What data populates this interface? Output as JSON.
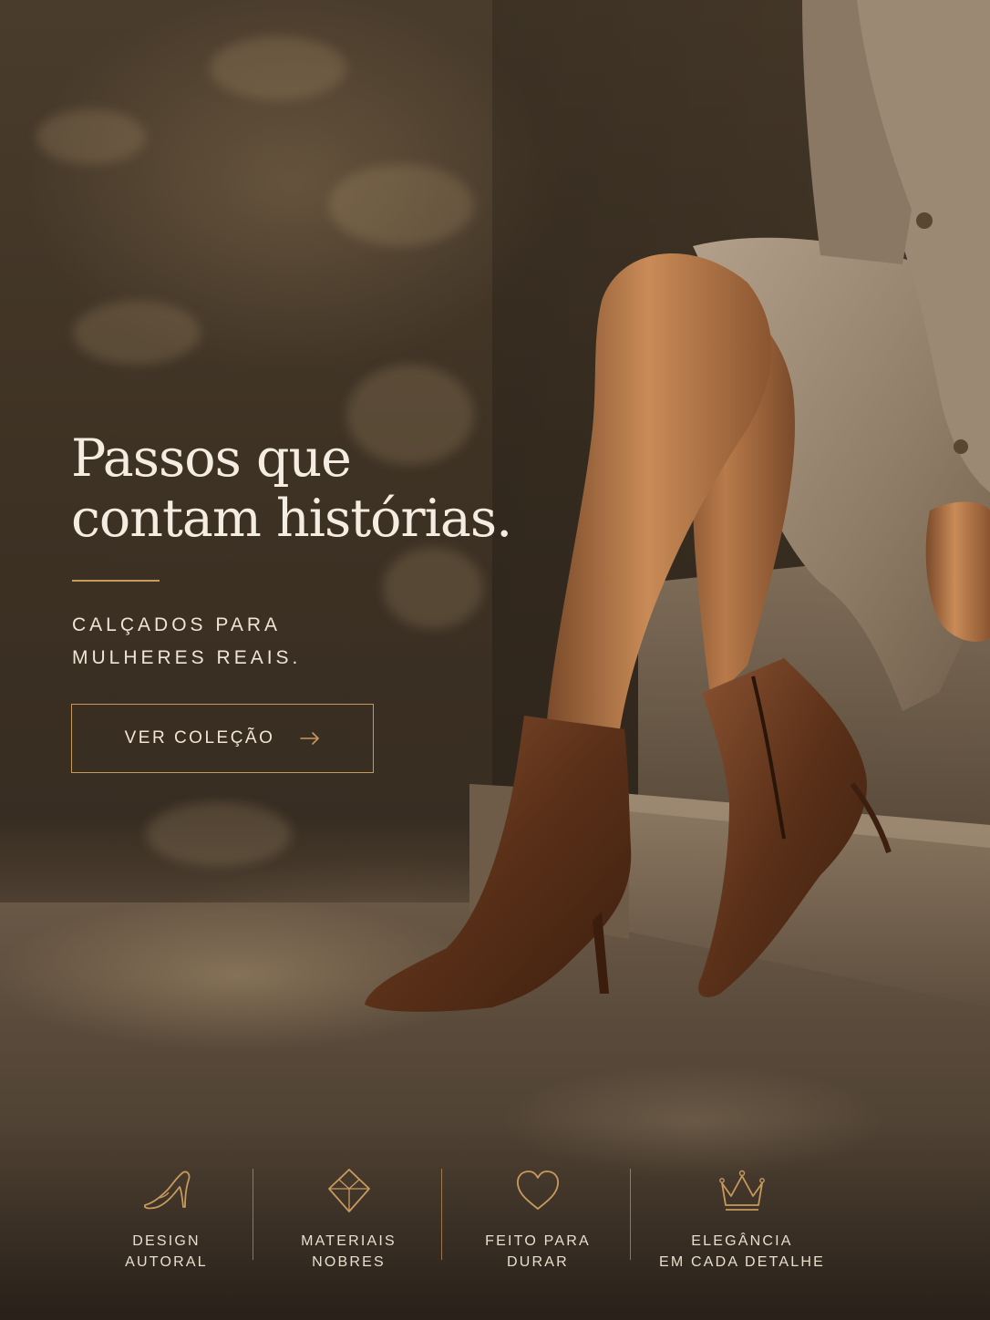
{
  "hero": {
    "title_line1": "Passos que",
    "title_line2": "contam histórias.",
    "subtitle_line1": "CALÇADOS PARA",
    "subtitle_line2": "MULHERES REAIS."
  },
  "cta": {
    "label": "VER COLEÇÃO",
    "icon": "arrow-right-icon"
  },
  "features": [
    {
      "icon": "high-heel-icon",
      "line1": "DESIGN",
      "line2": "AUTORAL"
    },
    {
      "icon": "diamond-icon",
      "line1": "MATERIAIS",
      "line2": "NOBRES"
    },
    {
      "icon": "heart-icon",
      "line1": "FEITO PARA",
      "line2": "DURAR"
    },
    {
      "icon": "crown-icon",
      "line1": "ELEGÂNCIA",
      "line2": "EM CADA DETALHE"
    }
  ],
  "colors": {
    "accent": "#c8995d",
    "text_light": "#f5ede1",
    "background": "#3e3224",
    "boot_leather": "#5a3018"
  }
}
